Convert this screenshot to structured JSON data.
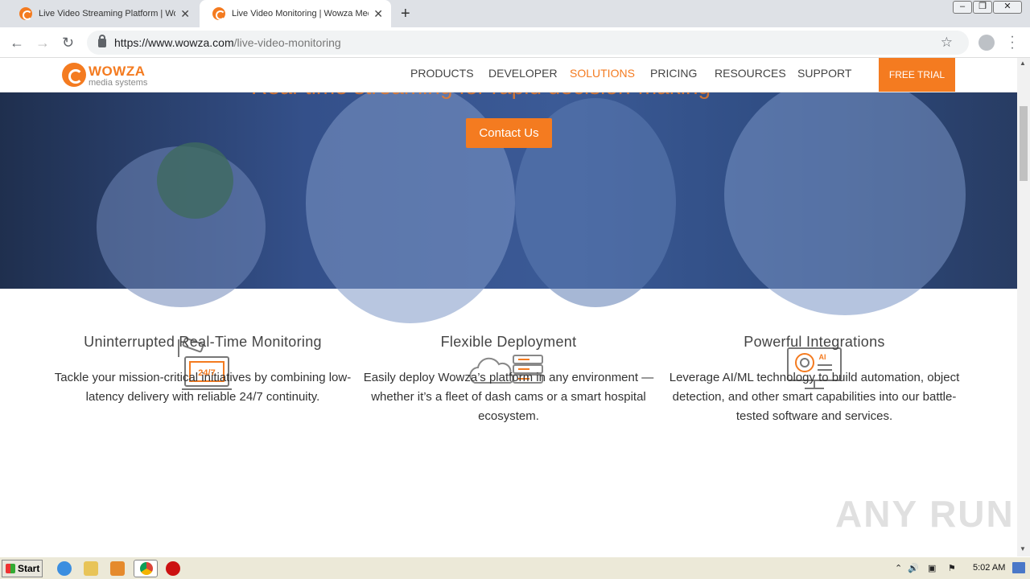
{
  "browser": {
    "tabs": [
      {
        "title": "Live Video Streaming Platform | Wowza Media Systems",
        "active": false
      },
      {
        "title": "Live Video Monitoring | Wowza Media Systems",
        "active": true
      }
    ],
    "new_tab": "+",
    "url_host": "https://www.wowza.com",
    "url_path": "/live-video-monitoring"
  },
  "site": {
    "logo_text": "WOWZA",
    "logo_sub": "media systems",
    "nav": [
      "PRODUCTS",
      "DEVELOPER",
      "SOLUTIONS",
      "PRICING",
      "RESOURCES",
      "SUPPORT"
    ],
    "active_nav": "SOLUTIONS",
    "cta": "FREE TRIAL"
  },
  "hero": {
    "headline": "Real-time streaming for rapid decision-making",
    "button": "Contact Us"
  },
  "features": [
    {
      "icon": "cctv-monitor-icon",
      "icon_label": "24/7",
      "title": "Uninterrupted Real-Time Monitoring",
      "text": "Tackle your mission-critical initiatives by combining low-latency delivery with reliable 24/7 continuity."
    },
    {
      "icon": "cloud-server-icon",
      "title": "Flexible Deployment",
      "text": "Easily deploy Wowza’s platform in any environment — whether it’s a fleet of dash cams or a smart hospital ecosystem."
    },
    {
      "icon": "ai-monitor-icon",
      "icon_label": "AI",
      "title": "Powerful Integrations",
      "text": "Leverage AI/ML technology to build automation, object detection, and other smart capabilities into our battle-tested software and services."
    }
  ],
  "watermark": "ANY RUN",
  "taskbar": {
    "start": "Start",
    "clock": "5:02 AM"
  },
  "colors": {
    "accent": "#f47b20",
    "hero_bg": "#34508a"
  }
}
